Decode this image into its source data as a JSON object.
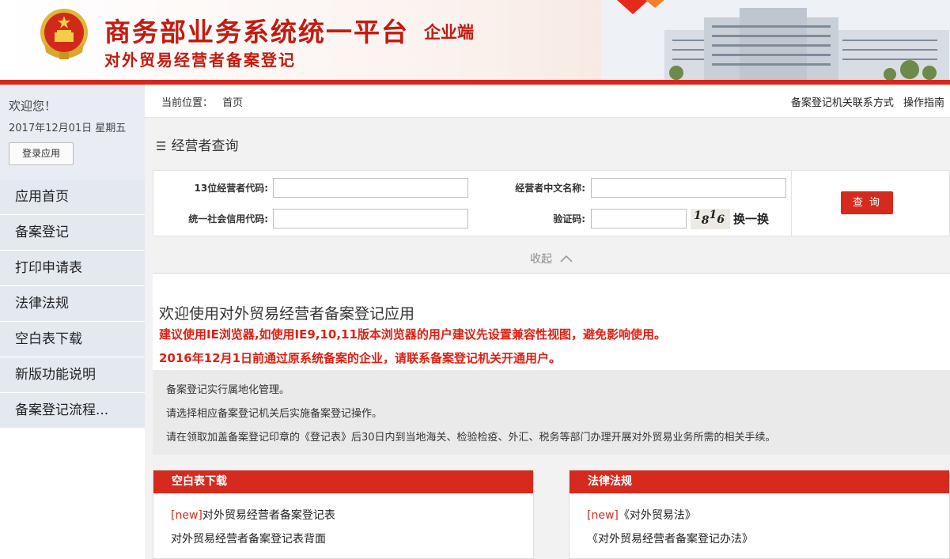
{
  "header": {
    "title": "商务部业务系统统一平台",
    "tag": "企业端",
    "subtitle": "对外贸易经营者备案登记"
  },
  "sidebar": {
    "welcome": "欢迎您！",
    "date": "2017年12月01日 星期五",
    "login_button": "登录应用",
    "items": [
      {
        "label": "应用首页"
      },
      {
        "label": "备案登记"
      },
      {
        "label": "打印申请表"
      },
      {
        "label": "法律法规"
      },
      {
        "label": "空白表下载"
      },
      {
        "label": "新版功能说明"
      },
      {
        "label": "备案登记流程..."
      }
    ]
  },
  "breadcrumb": {
    "prefix": "当前位置：",
    "current": "首页"
  },
  "top_links": {
    "contact": "备案登记机关联系方式",
    "guide": "操作指南"
  },
  "search": {
    "title": "经营者查询",
    "code_label": "13位经营者代码:",
    "name_label": "经营者中文名称:",
    "credit_label": "统一社会信用代码:",
    "captcha_label": "验证码:",
    "code_value": "",
    "name_value": "",
    "credit_value": "",
    "captcha_value": "",
    "captcha_chars": [
      "1",
      "8",
      "1",
      "6"
    ],
    "refresh": "换一换",
    "query_button": "查询",
    "collapse": "收起"
  },
  "welcome": {
    "title": "欢迎使用对外贸易经营者备案登记应用",
    "warning1": "建议使用IE浏览器,如使用IE9,10,11版本浏览器的用户建议先设置兼容性视图，避免影响使用。",
    "warning2": "2016年12月1日前通过原系统备案的企业，请联系备案登记机关开通用户。"
  },
  "notices": [
    "备案登记实行属地化管理。",
    "请选择相应备案登记机关后实施备案登记操作。",
    "请在领取加盖备案登记印章的《登记表》后30日内到当地海关、检验检疫、外汇、税务等部门办理开展对外贸易业务所需的相关手续。"
  ],
  "cards": {
    "downloads": {
      "title": "空白表下载",
      "items": [
        {
          "badge": "[new]",
          "text": "对外贸易经营者备案登记表"
        },
        {
          "badge": "",
          "text": "对外贸易经营者备案登记表背面"
        }
      ]
    },
    "laws": {
      "title": "法律法规",
      "items": [
        {
          "badge": "[new]",
          "text": "《对外贸易法》"
        },
        {
          "badge": "",
          "text": "《对外贸易经营者备案登记办法》"
        }
      ]
    }
  },
  "colors": {
    "brand_red": "#d62a1e",
    "title_red": "#c41a10",
    "warning_red": "#e01f12",
    "nav_bg": "#e4e9f0"
  }
}
